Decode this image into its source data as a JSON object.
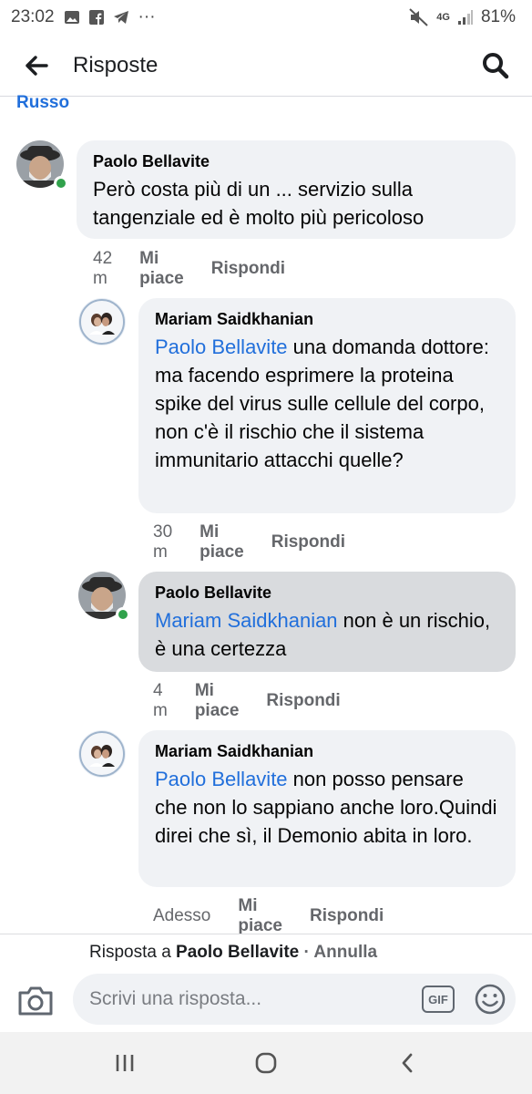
{
  "status_bar": {
    "time": "23:02",
    "dots": "···",
    "network": "4G",
    "battery": "81%"
  },
  "header": {
    "title": "Risposte"
  },
  "partial_name": "Russo",
  "comments": [
    {
      "author": "Paolo Bellavite",
      "text": "Però costa più di un ... servizio sulla tangenziale ed è molto più pericoloso",
      "time": "42 m",
      "like": "Mi piace",
      "reply": "Rispondi"
    },
    {
      "author": "Mariam Saidkhanian",
      "mention": "Paolo Bellavite",
      "text": " una domanda dottore: ma facendo esprimere la proteina spike del virus sulle cellule del corpo, non c'è il rischio che il sistema immunitario attacchi quelle?",
      "time": "30 m",
      "like": "Mi piace",
      "reply": "Rispondi"
    },
    {
      "author": "Paolo Bellavite",
      "mention": "Mariam Saidkhanian",
      "text": " non è un rischio, è una certezza",
      "time": "4 m",
      "like": "Mi piace",
      "reply": "Rispondi"
    },
    {
      "author": "Mariam Saidkhanian",
      "mention": "Paolo Bellavite",
      "text": " non posso pensare che non lo sappiano anche loro.Quindi direi che sì, il Demonio abita in loro.",
      "time": "Adesso",
      "like": "Mi piace",
      "reply": "Rispondi"
    }
  ],
  "reply_bar": {
    "prefix": "Risposta a ",
    "target": "Paolo Bellavite",
    "separator": " · ",
    "cancel": "Annulla"
  },
  "composer": {
    "placeholder": "Scrivi una risposta...",
    "gif": "GIF"
  },
  "colors": {
    "link": "#216fdb",
    "bubble": "#f0f2f5",
    "bubble_highlight": "#d9dbde",
    "online": "#31a24c"
  }
}
